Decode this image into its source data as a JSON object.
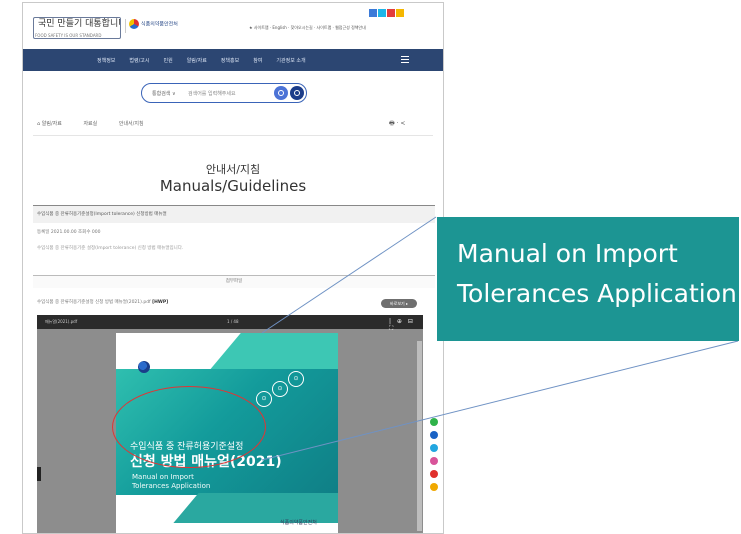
{
  "header": {
    "logo_main": "국민 만들기 대통합니다",
    "logo_sub": "FOOD SAFETY IS OUR STANDARD",
    "logo_agency": "식품의약품안전처",
    "utility_links": "★ 사이트맵 · English · 찾아오시는길 · 사이트맵 · 웹접근성 정책안내",
    "nav_items": [
      "정책정보",
      "법령/고시",
      "민원",
      "알림/자료",
      "정책홍보",
      "참여",
      "기관정보 소개"
    ],
    "search_select": "통합검색 ∨",
    "search_placeholder": "검색어를 입력해주세요"
  },
  "breadcrumb": [
    "⌂  알림/자료",
    "자료실",
    "안내서/지침"
  ],
  "tools": "🖶 · <",
  "page": {
    "title_ko": "안내서/지침",
    "title_en": "Manuals/Guidelines"
  },
  "document": {
    "heading": "수입식품 중 잔류허용기준설정(Import tolerance) 신청방법 매뉴얼",
    "meta": "등록일 2021.00.00    조회수 000",
    "description": "수입식품 중 잔류허용기준 설정(Import tolerance) 신청 방법 매뉴얼입니다.",
    "attachment_bar": "첨부파일",
    "attachment_name": "수입식품 중 잔류허용기준설정 신청 방법 매뉴얼(2021).pdf",
    "attachment_label": "[HWP]",
    "attachment_button": "바로보기 ▸"
  },
  "viewer": {
    "filename": "매뉴얼(2021).pdf",
    "page_indicator": "1 / 48",
    "tools": "| ⊕ ⊟ ⛶",
    "cover_title_ko_line1": "수입식품 중 잔류허용기준설정",
    "cover_title_ko_line2": "신청 방법 매뉴얼(2021)",
    "cover_title_en_line1": "Manual on Import",
    "cover_title_en_line2": "Tolerances Application",
    "cover_org": "식품의약품안전처"
  },
  "callout": {
    "line1": "Manual on Import",
    "line2": "Tolerances Application"
  },
  "colors": {
    "nav_bg": "#2c4672",
    "callout_bg": "#1c9593",
    "highlight": "#e03535",
    "leader_line": "#6f92c4"
  }
}
